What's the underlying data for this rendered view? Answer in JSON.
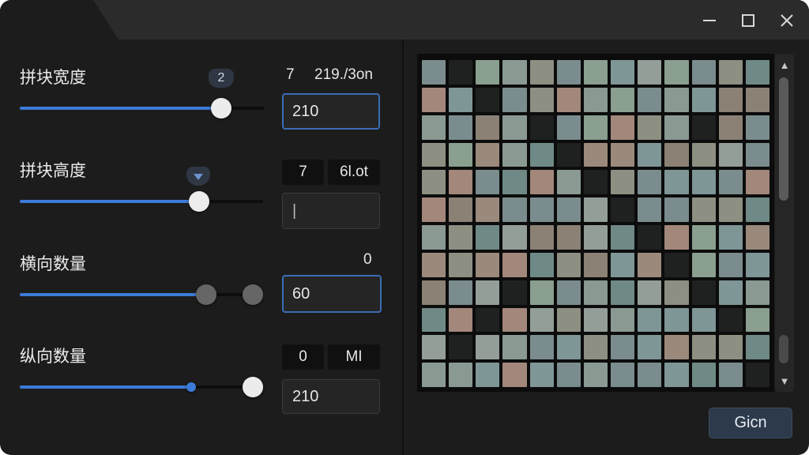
{
  "window": {
    "controls": {
      "minimize_icon": "minimize-icon",
      "maximize_icon": "maximize-icon",
      "close_icon": "close-icon"
    }
  },
  "settings": {
    "tile_width": {
      "label": "拼块宽度",
      "tooltip": "2",
      "value_a": "7",
      "value_b": "219./3on",
      "input_value": "210",
      "slider_fraction": 0.82
    },
    "tile_height": {
      "label": "拼块高度",
      "value_a": "7",
      "value_b": "6l.ot",
      "input_value": "|",
      "slider_fraction": 0.73
    },
    "horizontal_count": {
      "label": "横向数量",
      "value_a": "0",
      "input_value": "60",
      "slider_fraction": 0.76
    },
    "vertical_count": {
      "label": "纵向数量",
      "value_a": "0",
      "value_b": "MI",
      "input_value": "210",
      "slider_fraction": 0.71,
      "second_handle_fraction": 0.96
    }
  },
  "preview": {
    "scrollbar": {
      "up_icon": "▲",
      "down_icon": "▼"
    }
  },
  "action_button": {
    "label": "Gicn"
  },
  "colors": {
    "accent": "#3c7bd8",
    "window_bg": "#1c1c1c",
    "titlebar_bg": "#2b2b2b"
  }
}
